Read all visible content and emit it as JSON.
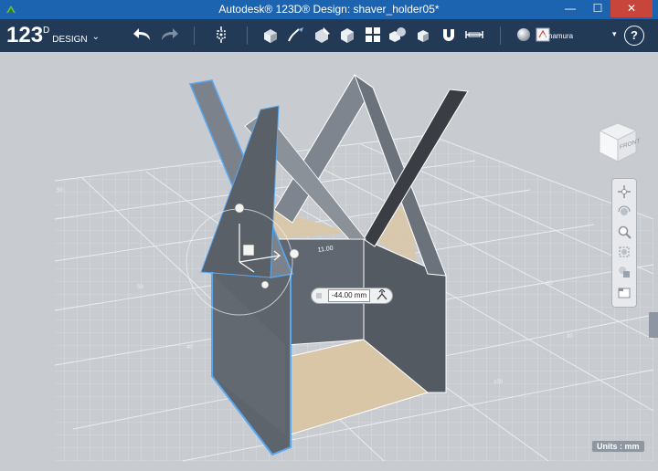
{
  "window": {
    "title": "Autodesk® 123D® Design: shaver_holder05*",
    "min_glyph": "—",
    "max_glyph": "☐",
    "close_glyph": "✕"
  },
  "logo": {
    "number": "123",
    "superscript": "D",
    "word": "DESIGN",
    "menu_glyph": "⌄"
  },
  "toolbar": {
    "icons": [
      "undo-icon",
      "redo-icon",
      "transform-icon",
      "primitives-icon",
      "sketch-icon",
      "construct-icon",
      "modify-icon",
      "pattern-icon",
      "grouping-icon",
      "combine-icon",
      "snap-icon",
      "measure-icon",
      "material-icon",
      "text-icon"
    ]
  },
  "user": {
    "name": "yimamura",
    "chevron": "▾",
    "help_glyph": "?"
  },
  "viewcube": {
    "face_label": "FRONT"
  },
  "navigation": {
    "items": [
      "pan-icon",
      "orbit-icon",
      "zoom-icon",
      "fit-icon",
      "visibility-icon",
      "material-icon"
    ]
  },
  "dimension": {
    "value": "-44.00 mm"
  },
  "grid_ruler": {
    "label": "11.00"
  },
  "status": {
    "units": "Units : mm"
  },
  "colors": {
    "titlebar": "#1c63b0",
    "toolbar": "#233a57",
    "viewport": "#c8ccd1",
    "model": "#5e646c",
    "selection": "#5aa8f0",
    "floor": "#d9c6a6"
  }
}
